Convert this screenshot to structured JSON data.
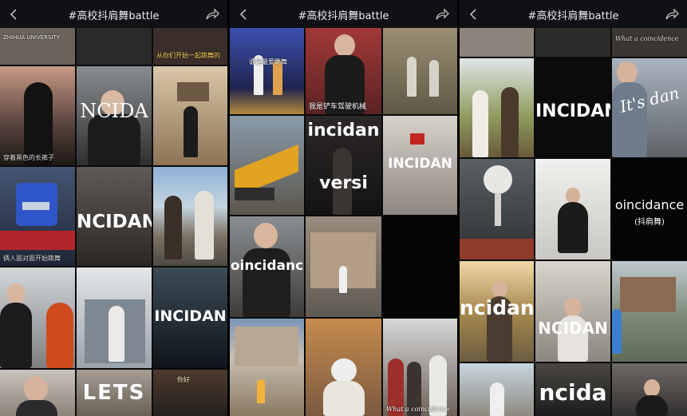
{
  "panels": [
    {
      "title": "#高校抖肩舞battle"
    },
    {
      "title": "#高校抖肩舞battle"
    },
    {
      "title": "#高校抖肩舞battle"
    }
  ],
  "tiles": {
    "p1_top_left": "ZHIHUA UNIVERSITY",
    "p1_top_right": "从你们开始一起跳舞的",
    "p1_incida": "NCIDA",
    "p1_caption_dusk": "穿着黑色的长裤子",
    "p1_incidan": "NCIDAN",
    "p1_caption_robot": "俩人面对面开始跳舞",
    "p1_incidan2": "INCIDAN",
    "p1_lets": "LETS",
    "p1_caption_gate": "你好",
    "p2_stage_caption": "谁是最爱跳舞",
    "p2_caption_crane": "我是铲车驾驶机械",
    "p2_incidan": "incidan",
    "p2_versity": "versi",
    "p2_incidan_right": "INCIDAN",
    "p2_oincidanc": "oincidanc",
    "p2_coincidence": "What a coincidence",
    "p3_coincidence_top": "What a coincidence",
    "p3_incidan": "INCIDAN",
    "p3_its": "It's dan",
    "p3_oincidance": "oincidance",
    "p3_sub": "(抖肩舞)",
    "p3_incidan_bottom": "ncidan",
    "p3_incidan_mid": "NCIDAN",
    "p3_incida_bottom": "ncida"
  },
  "colors": {
    "topbar": "#101114",
    "title": "#e9e9ea"
  }
}
